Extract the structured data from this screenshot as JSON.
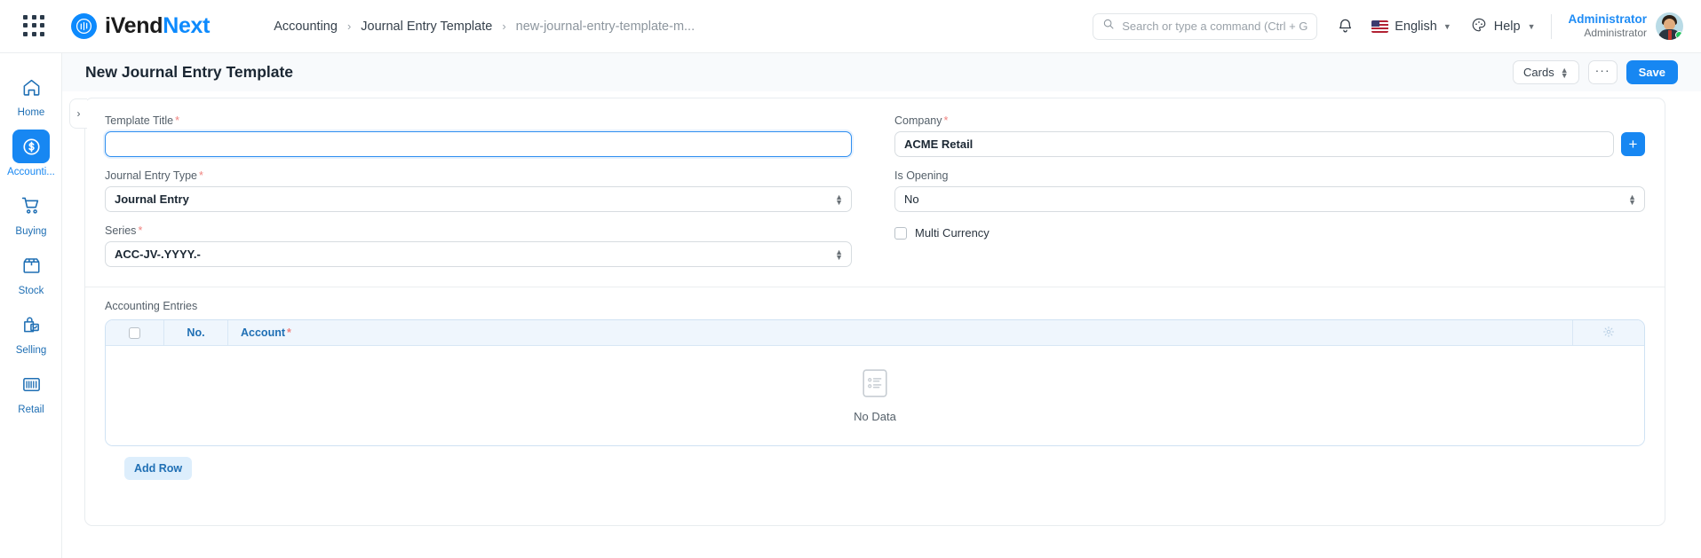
{
  "navbar": {
    "apps_icon": "apps-grid-icon",
    "brand": {
      "part1": "iVend",
      "part2": "Next",
      "logo_icon": "ivend-logo-icon"
    },
    "breadcrumb": [
      {
        "label": "Accounting",
        "current": false
      },
      {
        "label": "Journal Entry Template",
        "current": false
      },
      {
        "label": "new-journal-entry-template-m...",
        "current": true
      }
    ],
    "breadcrumb_separator": "›",
    "search": {
      "placeholder": "Search or type a command (Ctrl + G)",
      "value": "",
      "icon": "search-icon"
    },
    "notifications_icon": "bell-icon",
    "language": {
      "label": "English",
      "flag_icon": "us-flag-icon",
      "caret": "⌄"
    },
    "help": {
      "label": "Help",
      "icon": "palette-icon",
      "caret": "⌄"
    },
    "user": {
      "name": "Administrator",
      "role": "Administrator",
      "avatar_icon": "user-avatar",
      "status": "online"
    }
  },
  "sidebar": {
    "items": [
      {
        "label": "Home",
        "icon": "home-icon",
        "active": false
      },
      {
        "label": "Accounti...",
        "icon": "dollar-circle-icon",
        "active": true
      },
      {
        "label": "Buying",
        "icon": "shopping-cart-icon",
        "active": false
      },
      {
        "label": "Stock",
        "icon": "box-icon",
        "active": false
      },
      {
        "label": "Selling",
        "icon": "shopping-bag-icon",
        "active": false
      },
      {
        "label": "Retail",
        "icon": "barcode-icon",
        "active": false
      }
    ]
  },
  "page_header": {
    "title": "New Journal Entry Template",
    "cards_label": "Cards",
    "menu_label": "···",
    "save_label": "Save"
  },
  "form": {
    "collapse_icon": "chevron-right-icon",
    "left": {
      "template_title": {
        "label": "Template Title",
        "required": true,
        "value": "",
        "focused": true
      },
      "journal_entry_type": {
        "label": "Journal Entry Type",
        "required": true,
        "value": "Journal Entry"
      },
      "series": {
        "label": "Series",
        "required": true,
        "value": "ACC-JV-.YYYY.-"
      }
    },
    "right": {
      "company": {
        "label": "Company",
        "required": true,
        "value": "ACME Retail",
        "add_button": "+"
      },
      "is_opening": {
        "label": "Is Opening",
        "required": false,
        "value": "No"
      },
      "multi_currency": {
        "label": "Multi Currency",
        "checked": false
      }
    }
  },
  "table": {
    "title": "Accounting Entries",
    "columns": [
      {
        "key": "select",
        "label": "",
        "required": false
      },
      {
        "key": "no",
        "label": "No.",
        "required": false
      },
      {
        "key": "account",
        "label": "Account",
        "required": true
      },
      {
        "key": "settings",
        "label": "",
        "required": false,
        "icon": "gear-icon"
      }
    ],
    "rows": [],
    "empty_state": {
      "label": "No Data",
      "icon": "no-data-document-icon"
    },
    "add_row_label": "Add Row"
  },
  "colors": {
    "accent": "#1787f2",
    "brand_blue": "#0d8afd",
    "link_blue": "#1f6fb4",
    "required_red": "#f0837f",
    "page_bg": "#f8fafc",
    "status_green": "#22c55e"
  }
}
